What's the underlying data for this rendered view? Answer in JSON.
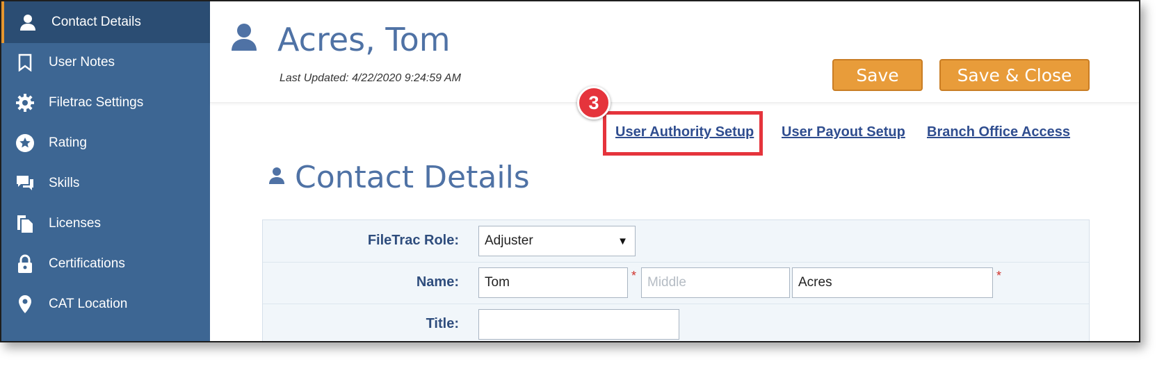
{
  "sidebar": {
    "items": [
      {
        "label": "Contact Details",
        "icon": "person-icon",
        "active": true
      },
      {
        "label": "User Notes",
        "icon": "bookmark-icon"
      },
      {
        "label": "Filetrac Settings",
        "icon": "gear-icon"
      },
      {
        "label": "Rating",
        "icon": "star-icon"
      },
      {
        "label": "Skills",
        "icon": "chat-bubbles-icon"
      },
      {
        "label": "Licenses",
        "icon": "documents-icon"
      },
      {
        "label": "Certifications",
        "icon": "lock-icon"
      },
      {
        "label": "CAT Location",
        "icon": "map-pin-icon"
      }
    ]
  },
  "header": {
    "title": "Acres, Tom",
    "last_updated": "Last Updated: 4/22/2020 9:24:59 AM",
    "save_label": "Save",
    "save_close_label": "Save & Close"
  },
  "links": {
    "authority": "User Authority Setup",
    "payout": "User Payout Setup",
    "branch": "Branch Office Access"
  },
  "callout": {
    "step": "3"
  },
  "section": {
    "title": "Contact Details"
  },
  "form": {
    "role_label": "FileTrac Role:",
    "role_value": "Adjuster",
    "name_label": "Name:",
    "first_name": "Tom",
    "middle_placeholder": "Middle",
    "last_name": "Acres",
    "title_label": "Title:",
    "title_value": ""
  },
  "colors": {
    "sidebar_bg": "#3d6693",
    "sidebar_active": "#2b4d73",
    "accent_orange": "#e89c3a",
    "title_blue": "#4f72a5",
    "highlight_red": "#e5343c"
  }
}
